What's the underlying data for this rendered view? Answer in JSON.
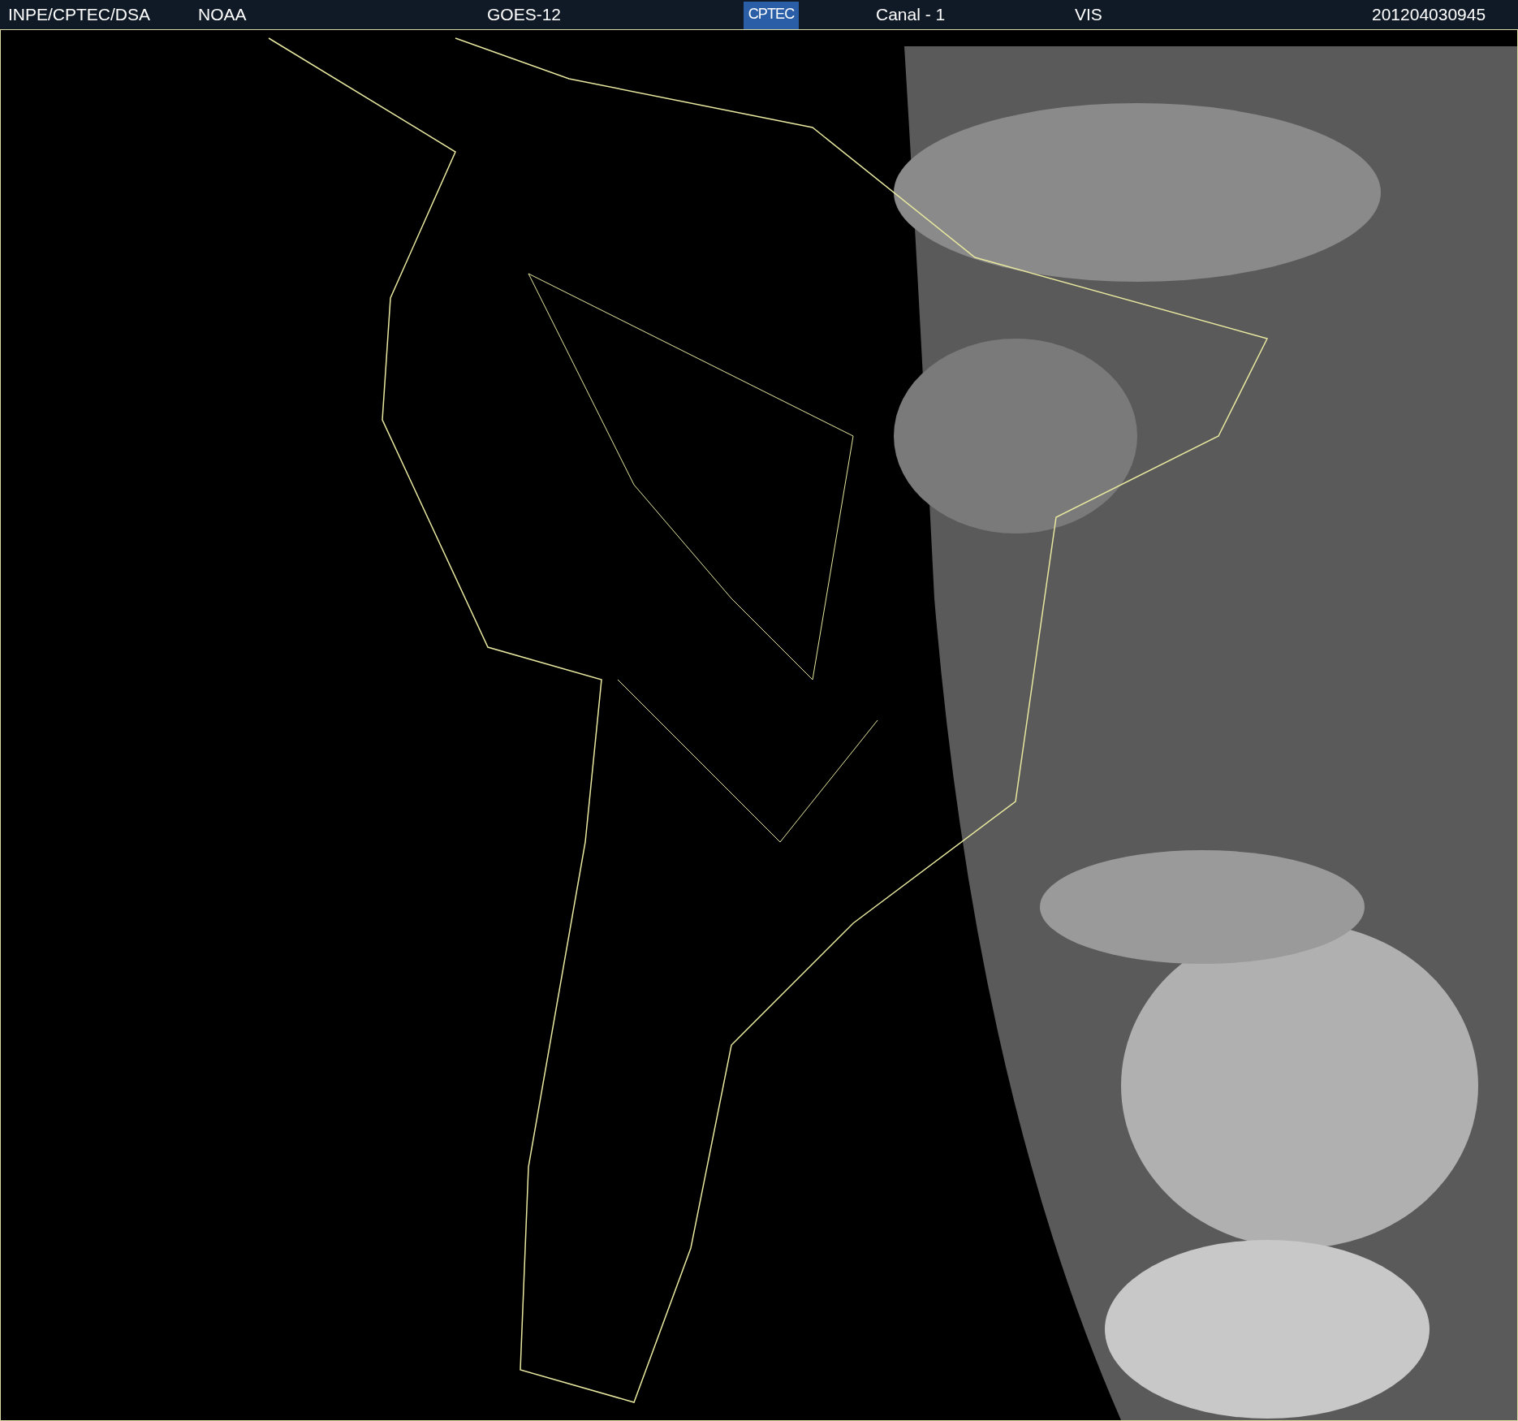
{
  "header": {
    "source": "INPE/CPTEC/DSA",
    "agency": "NOAA",
    "satellite": "GOES-12",
    "logo": "CPTEC",
    "channel": "Canal - 1",
    "band": "VIS",
    "timestamp": "201204030945"
  }
}
